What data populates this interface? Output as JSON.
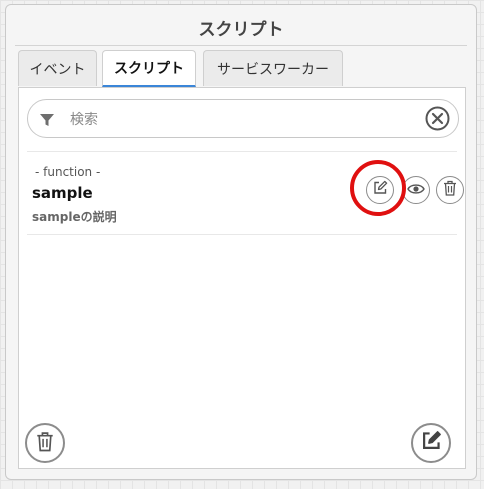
{
  "panel": {
    "title": "スクリプト"
  },
  "tabs": [
    {
      "label": "イベント",
      "active": false
    },
    {
      "label": "スクリプト",
      "active": true
    },
    {
      "label": "サービスワーカー",
      "active": false
    }
  ],
  "search": {
    "placeholder": "検索",
    "value": ""
  },
  "scripts": [
    {
      "kind": "- function -",
      "name": "sample",
      "description": "sampleの説明"
    }
  ],
  "icons": {
    "filter": "filter-icon",
    "clear": "clear-circle-icon",
    "edit": "edit-icon",
    "view": "eye-icon",
    "delete": "trash-icon",
    "delete_all": "trash-icon",
    "new": "edit-icon"
  },
  "colors": {
    "active_tab_underline": "#3b86d8",
    "highlight_ring": "#e01010"
  }
}
